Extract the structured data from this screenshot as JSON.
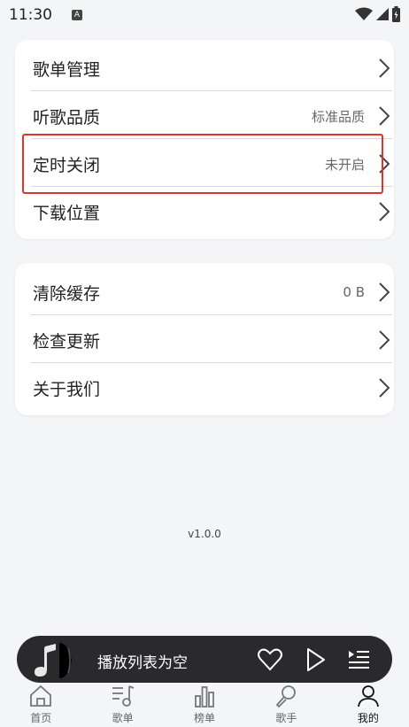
{
  "status": {
    "time": "11:30",
    "badge": "A"
  },
  "settings_group_1": [
    {
      "label": "歌单管理",
      "value": ""
    },
    {
      "label": "听歌品质",
      "value": "标准品质"
    },
    {
      "label": "定时关闭",
      "value": "未开启"
    },
    {
      "label": "下载位置",
      "value": ""
    }
  ],
  "settings_group_2": [
    {
      "label": "清除缓存",
      "value": "0 B"
    },
    {
      "label": "检查更新",
      "value": ""
    },
    {
      "label": "关于我们",
      "value": ""
    }
  ],
  "version": "v1.0.0",
  "player": {
    "text": "播放列表为空"
  },
  "nav": [
    {
      "label": "首页",
      "icon": "home-icon"
    },
    {
      "label": "歌单",
      "icon": "playlist-icon"
    },
    {
      "label": "榜单",
      "icon": "chart-icon"
    },
    {
      "label": "歌手",
      "icon": "microphone-icon"
    },
    {
      "label": "我的",
      "icon": "person-icon"
    }
  ],
  "colors": {
    "highlight": "#e0352b",
    "player_bg": "#2a2a2c",
    "page_bg": "#f4f5f7"
  }
}
